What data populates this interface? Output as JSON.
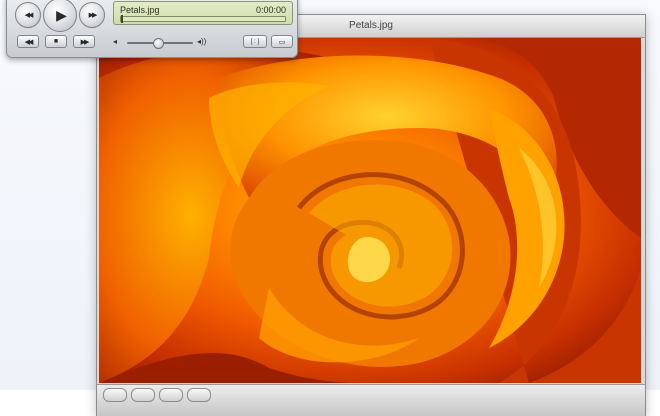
{
  "viewer": {
    "title": "Petals.jpg"
  },
  "player": {
    "file_name": "Petals.jpg",
    "time": "0:00:00",
    "playback_position": 0.0,
    "volume_level": 0.45,
    "buttons": {
      "rewind_icon": "◀◀",
      "play_icon": "▶",
      "fast_forward_icon": "▶▶",
      "step_back_icon": "◀◀",
      "stop_icon": "■",
      "step_forward_icon": "▶▶",
      "volume_low_icon": "◂",
      "volume_high_icon": "◂))",
      "size_button_icon": "[ : ]",
      "fullscreen_button_icon": "▭"
    }
  },
  "colors": {
    "accent_orange": "#f06a00",
    "lcd_green": "#d8e3b8"
  }
}
